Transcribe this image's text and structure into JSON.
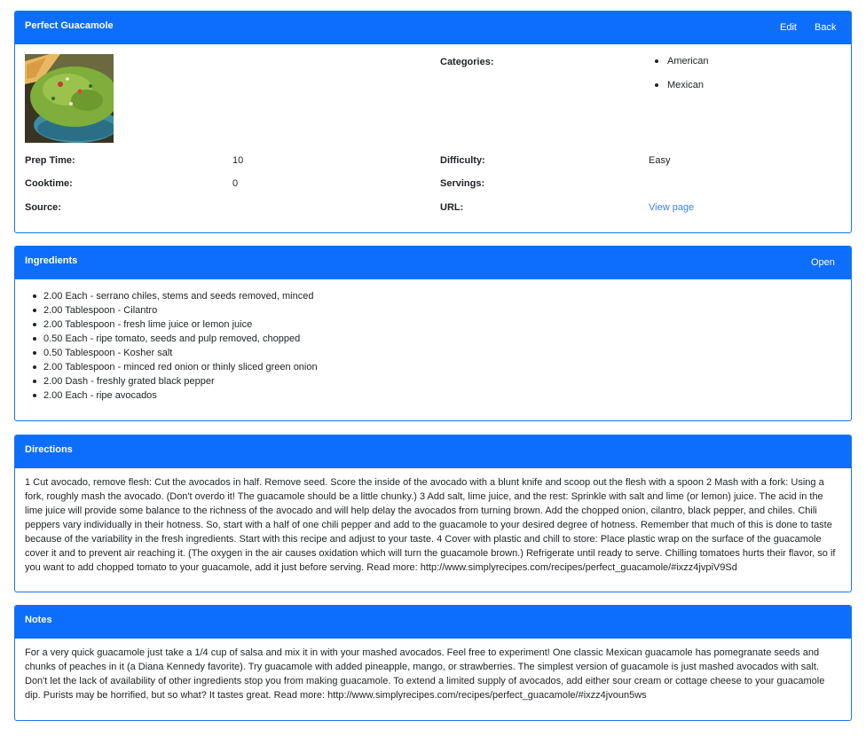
{
  "recipe": {
    "title": "Perfect Guacamole",
    "edit_label": "Edit",
    "back_label": "Back",
    "photo_alt": "guacamole bowl",
    "categories_label": "Categories:",
    "categories": [
      "American",
      "Mexican"
    ],
    "prep_time_label": "Prep Time:",
    "prep_time": "10",
    "cooktime_label": "Cooktime:",
    "cooktime": "0",
    "source_label": "Source:",
    "source": "",
    "difficulty_label": "Difficulty:",
    "difficulty": "Easy",
    "servings_label": "Servings:",
    "servings": "",
    "url_label": "URL:",
    "url_link_text": "View page"
  },
  "ingredients": {
    "title": "Ingredients",
    "open_label": "Open",
    "items": [
      "2.00 Each - serrano chiles, stems and seeds removed, minced",
      "2.00 Tablespoon - Cilantro",
      "2.00 Tablespoon - fresh lime juice or lemon juice",
      "0.50 Each - ripe tomato, seeds and pulp removed, chopped",
      "0.50 Tablespoon - Kosher salt",
      "2.00 Tablespoon - minced red onion or thinly sliced green onion",
      "2.00 Dash - freshly grated black pepper",
      "2.00 Each - ripe avocados"
    ]
  },
  "directions": {
    "title": "Directions",
    "text": "1 Cut avocado, remove flesh: Cut the avocados in half. Remove seed. Score the inside of the avocado with a blunt knife and scoop out the flesh with a spoon 2 Mash with a fork: Using a fork, roughly mash the avocado. (Don't overdo it! The guacamole should be a little chunky.) 3 Add salt, lime juice, and the rest: Sprinkle with salt and lime (or lemon) juice. The acid in the lime juice will provide some balance to the richness of the avocado and will help delay the avocados from turning brown. Add the chopped onion, cilantro, black pepper, and chiles. Chili peppers vary individually in their hotness. So, start with a half of one chili pepper and add to the guacamole to your desired degree of hotness. Remember that much of this is done to taste because of the variability in the fresh ingredients. Start with this recipe and adjust to your taste. 4 Cover with plastic and chill to store: Place plastic wrap on the surface of the guacamole cover it and to prevent air reaching it. (The oxygen in the air causes oxidation which will turn the guacamole brown.) Refrigerate until ready to serve. Chilling tomatoes hurts their flavor, so if you want to add chopped tomato to your guacamole, add it just before serving. Read more: http://www.simplyrecipes.com/recipes/perfect_guacamole/#ixzz4jvpiV9Sd"
  },
  "notes": {
    "title": "Notes",
    "text": "For a very quick guacamole just take a 1/4 cup of salsa and mix it in with your mashed avocados. Feel free to experiment! One classic Mexican guacamole has pomegranate seeds and chunks of peaches in it (a Diana Kennedy favorite). Try guacamole with added pineapple, mango, or strawberries. The simplest version of guacamole is just mashed avocados with salt. Don't let the lack of availability of other ingredients stop you from making guacamole. To extend a limited supply of avocados, add either sour cream or cottage cheese to your guacamole dip. Purists may be horrified, but so what? It tastes great. Read more: http://www.simplyrecipes.com/recipes/perfect_guacamole/#ixzz4jvoun5ws"
  },
  "colors": {
    "header_blue": "#0d6efd",
    "border_blue": "#1a73e8",
    "link_blue": "#3b82e6"
  }
}
